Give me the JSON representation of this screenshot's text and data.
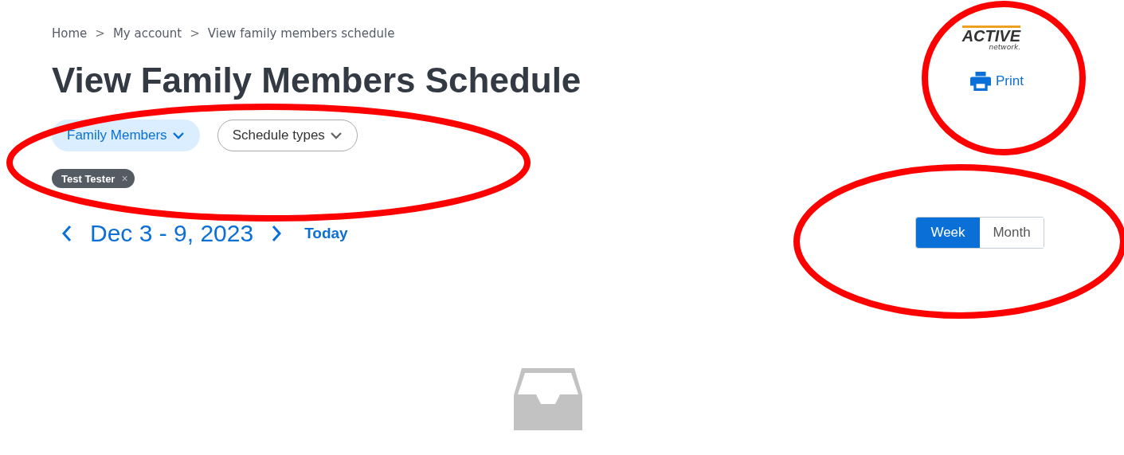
{
  "logo": {
    "word": "ACTIVE",
    "sub": "network."
  },
  "breadcrumb": [
    {
      "label": "Home"
    },
    {
      "label": "My account"
    },
    {
      "label": "View family members schedule"
    }
  ],
  "breadcrumb_separator": ">",
  "title": "View Family Members Schedule",
  "print": {
    "label": "Print"
  },
  "filters": [
    {
      "label": "Family Members",
      "selected": true
    },
    {
      "label": "Schedule types",
      "selected": false
    }
  ],
  "chips": [
    {
      "label": "Test Tester",
      "remove": "×"
    }
  ],
  "date_nav": {
    "range": "Dec 3 - 9, 2023",
    "today": "Today"
  },
  "view_toggle": [
    {
      "label": "Week",
      "selected": true
    },
    {
      "label": "Month",
      "selected": false
    }
  ]
}
